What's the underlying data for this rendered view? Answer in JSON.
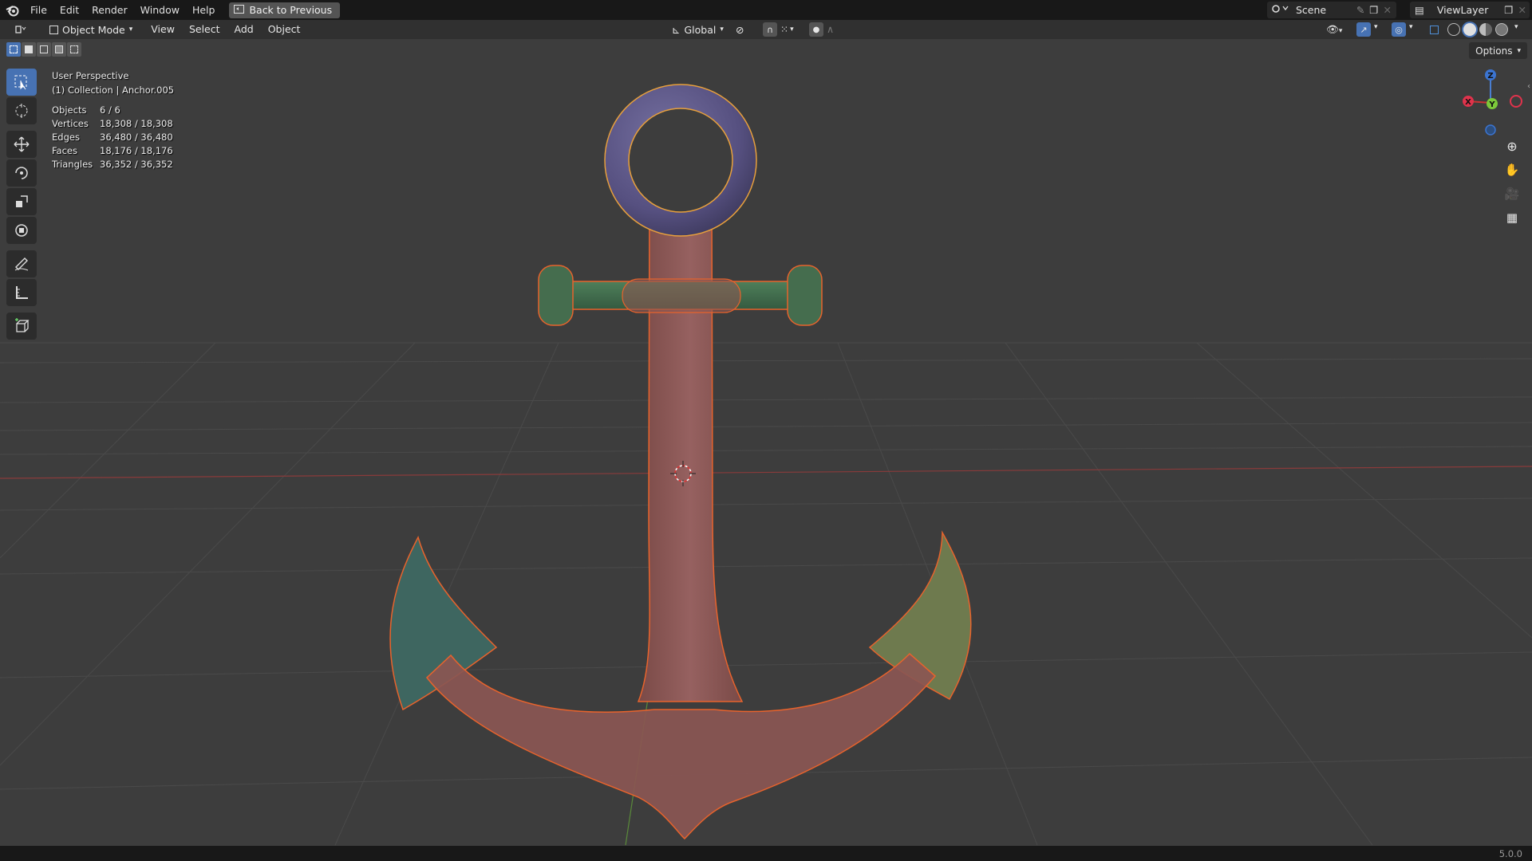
{
  "topbar": {
    "menus": [
      "File",
      "Edit",
      "Render",
      "Window",
      "Help"
    ],
    "back_label": "Back to Previous",
    "scene_label": "Scene",
    "viewlayer_label": "ViewLayer"
  },
  "header": {
    "mode_label": "Object Mode",
    "menus": [
      "View",
      "Select",
      "Add",
      "Object"
    ],
    "orientation_label": "Global"
  },
  "viewport": {
    "options_label": "Options",
    "view_name": "User Perspective",
    "collection_line": "(1) Collection | Anchor.005",
    "stats": [
      {
        "label": "Objects",
        "value": "6 / 6"
      },
      {
        "label": "Vertices",
        "value": "18,308 / 18,308"
      },
      {
        "label": "Edges",
        "value": "36,480 / 36,480"
      },
      {
        "label": "Faces",
        "value": "18,176 / 18,176"
      },
      {
        "label": "Triangles",
        "value": "36,352 / 36,352"
      }
    ],
    "gizmo": {
      "x": "X",
      "y": "Y",
      "z": "Z"
    }
  },
  "tools": [
    "select-box",
    "cursor",
    "move",
    "rotate",
    "scale",
    "transform",
    "annotate",
    "measure",
    "add-cube"
  ],
  "statusbar": {
    "version": "5.0.0"
  },
  "colors": {
    "accent": "#4772b3",
    "selection_outline": "#e8632c",
    "ring": "#5a5580",
    "stock": "#3f6b49",
    "shank": "#8a5652",
    "fluke_left": "#3e6660",
    "fluke_right": "#6e7a4e"
  }
}
